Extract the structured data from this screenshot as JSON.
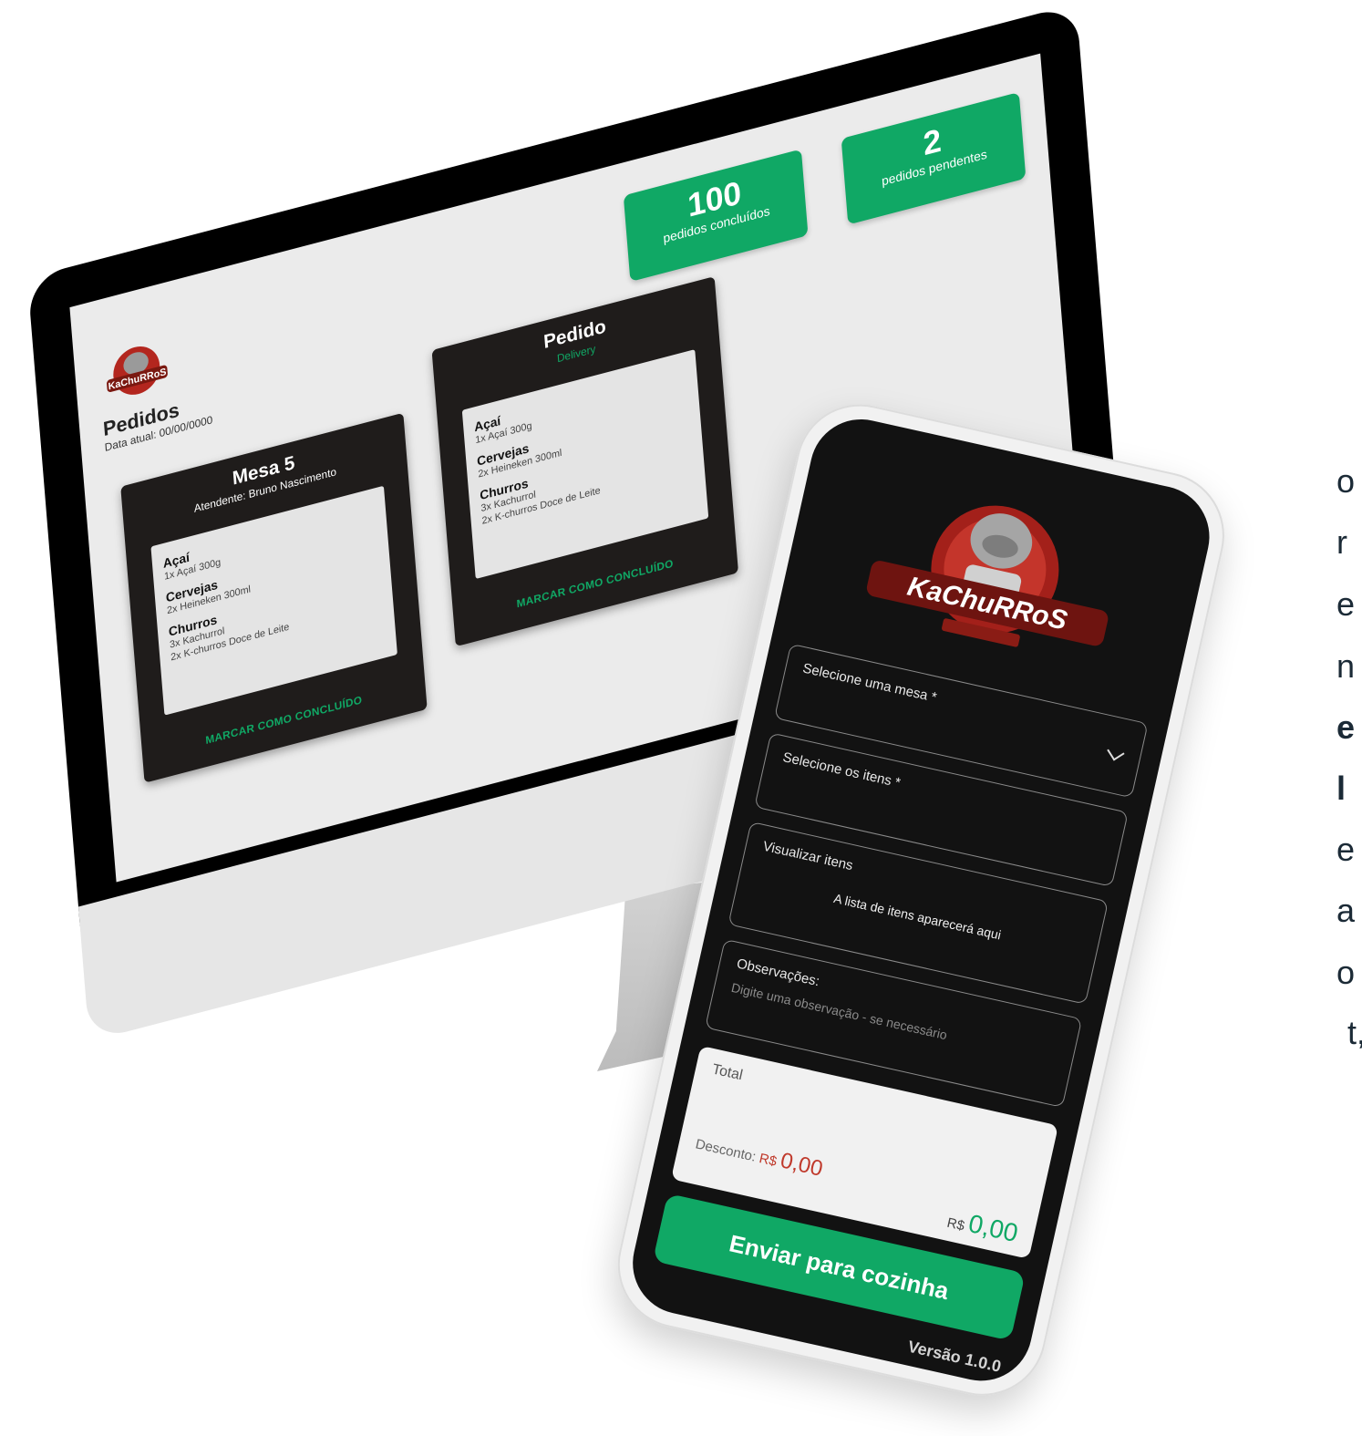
{
  "desktop": {
    "title": "Pedidos",
    "date_label": "Data atual: 00/00/0000",
    "stats": [
      {
        "number": "100",
        "label": "pedidos concluídos"
      },
      {
        "number": "2",
        "label": "pedidos pendentes"
      }
    ],
    "orders": [
      {
        "title": "Mesa 5",
        "subtitle": "Atendente: Bruno Nascimento",
        "groups": [
          {
            "category": "Açaí",
            "items": [
              "1x Açaí 300g"
            ]
          },
          {
            "category": "Cervejas",
            "items": [
              "2x Heineken 300ml"
            ]
          },
          {
            "category": "Churros",
            "items": [
              "3x Kachurrol",
              "2x K-churros Doce de Leite"
            ]
          }
        ],
        "action": "MARCAR COMO CONCLUÍDO"
      },
      {
        "title": "Pedido",
        "subtitle": "Delivery",
        "groups": [
          {
            "category": "Açaí",
            "items": [
              "1x Açaí 300g"
            ]
          },
          {
            "category": "Cervejas",
            "items": [
              "2x Heineken 300ml"
            ]
          },
          {
            "category": "Churros",
            "items": [
              "3x Kachurrol",
              "2x K-churros Doce de Leite"
            ]
          }
        ],
        "action": "MARCAR COMO CONCLUÍDO"
      }
    ]
  },
  "mobile": {
    "brand": "KaChuRRoS",
    "select_table": "Selecione uma mesa *",
    "select_items": "Selecione os itens *",
    "view_items_label": "Visualizar itens",
    "view_items_empty": "A lista de itens aparecerá aqui",
    "notes_label": "Observações:",
    "notes_placeholder": "Digite uma observação - se necessário",
    "total_label": "Total",
    "discount_label": "Desconto:",
    "currency": "R$",
    "discount_value": "0,00",
    "total_value": "0,00",
    "send_button": "Enviar para cozinha",
    "version": "Versão 1.0.0"
  },
  "side_text": [
    "o",
    "r",
    "e",
    "n",
    "e",
    "l",
    "e",
    "a",
    "o",
    "t,"
  ],
  "colors": {
    "accent": "#10a865",
    "discount": "#c0392b",
    "card": "#1f1c1b"
  }
}
